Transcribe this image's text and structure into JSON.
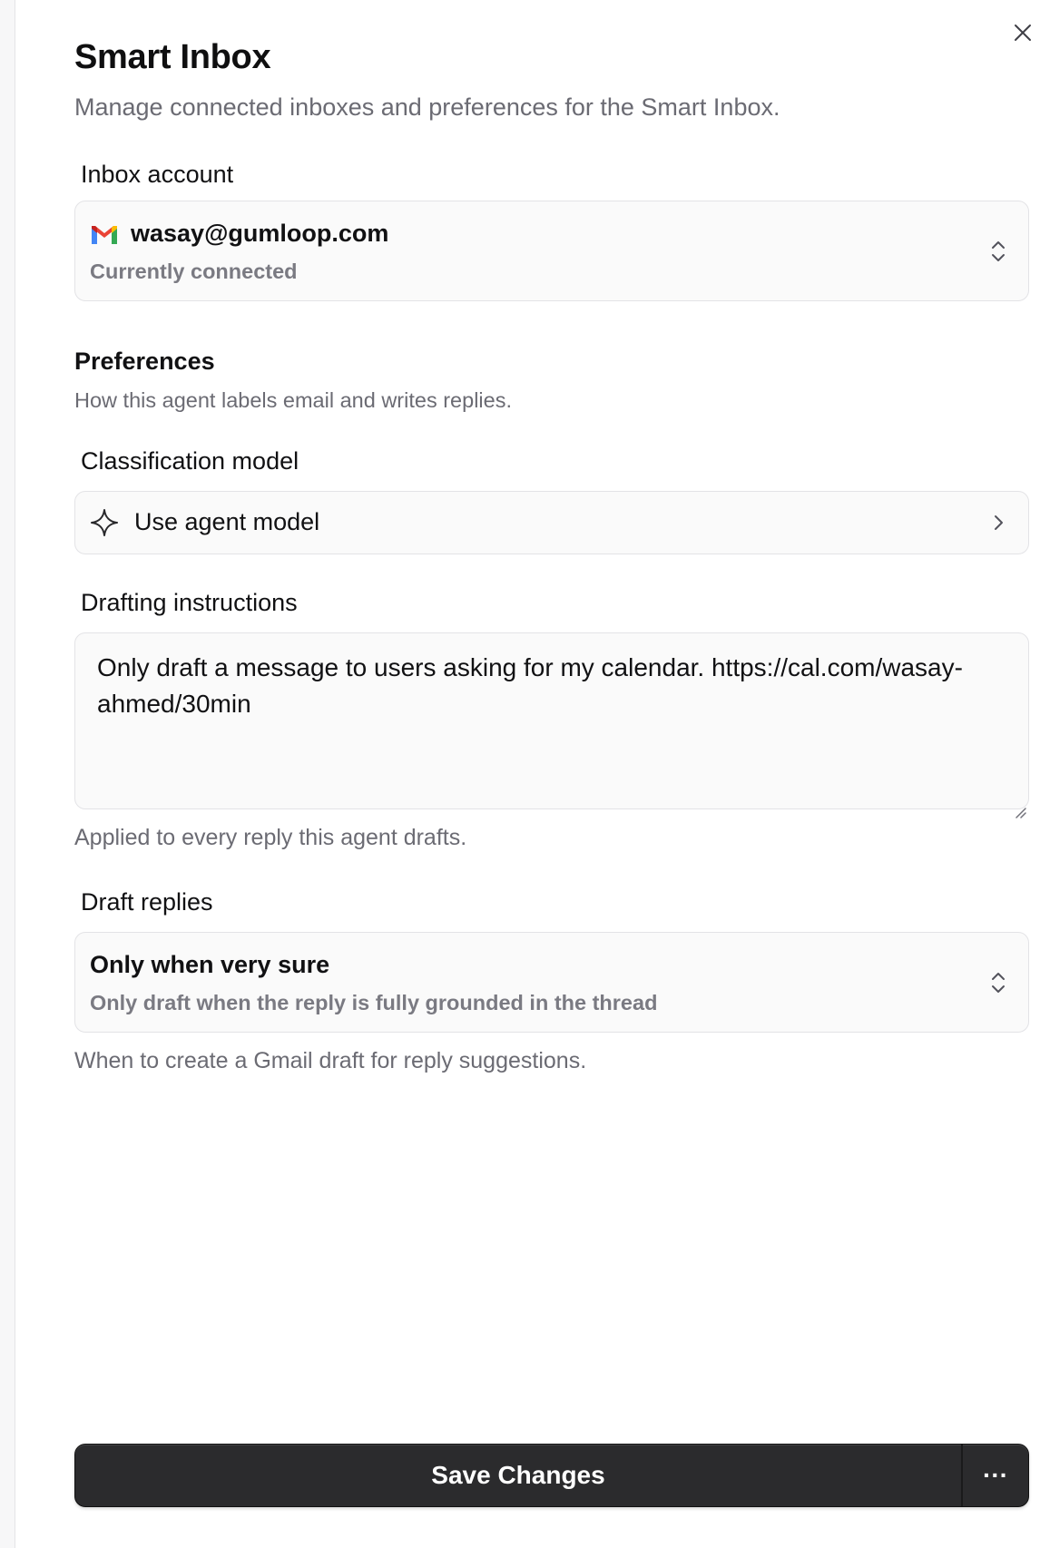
{
  "dialog": {
    "title": "Smart Inbox",
    "subtitle": "Manage connected inboxes and preferences for the Smart Inbox.",
    "close_icon": "close-icon"
  },
  "inbox_account": {
    "label": "Inbox account",
    "email": "wasay@gumloop.com",
    "status": "Currently connected",
    "icon": "gmail-icon"
  },
  "preferences": {
    "title": "Preferences",
    "description": "How this agent labels email and writes replies."
  },
  "classification_model": {
    "label": "Classification model",
    "value": "Use agent model",
    "icon": "sparkle-icon"
  },
  "drafting_instructions": {
    "label": "Drafting instructions",
    "value": "Only draft a message to users asking for my calendar. https://cal.com/wasay-ahmed/30min",
    "help": "Applied to every reply this agent drafts."
  },
  "draft_replies": {
    "label": "Draft replies",
    "value": "Only when very sure",
    "description": "Only draft when the reply is fully grounded in the thread",
    "help": "When to create a Gmail draft for reply suggestions."
  },
  "footer": {
    "save_label": "Save Changes",
    "more_label": "···"
  },
  "colors": {
    "accent": "#2b2b2d",
    "muted_text": "#6b6b73",
    "border": "#e3e3e6"
  }
}
